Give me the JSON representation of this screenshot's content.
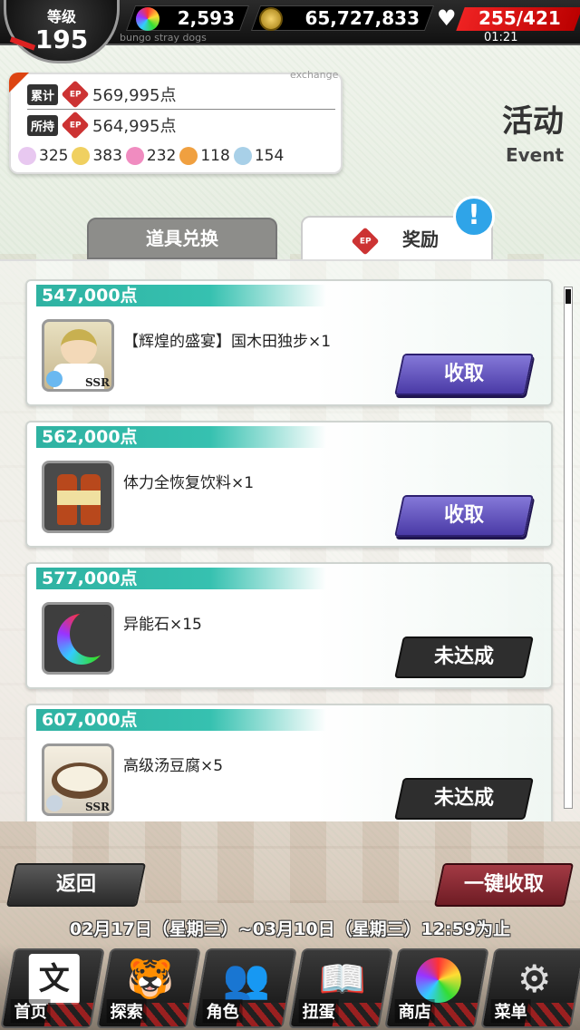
{
  "header": {
    "level_label": "等级",
    "level_value": "195",
    "gems": "2,593",
    "coins": "65,727,833",
    "stamina": "255/421",
    "stamina_timer": "01:21",
    "subtitle": "bungo stray dogs"
  },
  "points": {
    "exchange_label": "exchange",
    "total_label": "累计",
    "total_value": "569,995点",
    "owned_label": "所持",
    "owned_value": "564,995点",
    "ep_icon": "EP",
    "materials": [
      {
        "icon": "flower-icon",
        "count": "325"
      },
      {
        "icon": "ribbon-icon",
        "count": "383"
      },
      {
        "icon": "bouquet-icon",
        "count": "232"
      },
      {
        "icon": "medal-icon",
        "count": "118"
      },
      {
        "icon": "charm-icon",
        "count": "154"
      }
    ]
  },
  "event": {
    "title_cn": "活动",
    "title_en": "Event"
  },
  "tabs": {
    "exchange": "道具兑换",
    "reward": "奖励",
    "ep_icon": "EP",
    "alert": "!"
  },
  "rewards": [
    {
      "points": "547,000点",
      "name": "【辉煌的盛宴】国木田独步×1",
      "rarity": "SSR",
      "button": "收取",
      "state": "claimable"
    },
    {
      "points": "562,000点",
      "name": "体力全恢复饮料×1",
      "rarity": "",
      "button": "收取",
      "state": "claimable"
    },
    {
      "points": "577,000点",
      "name": "异能石×15",
      "rarity": "",
      "button": "未达成",
      "state": "locked"
    },
    {
      "points": "607,000点",
      "name": "高级汤豆腐×5",
      "rarity": "SSR",
      "button": "未达成",
      "state": "locked"
    }
  ],
  "footer": {
    "back": "返回",
    "claim_all": "一键收取",
    "period": "02月17日（星期三）~03月10日（星期三）12:59为止"
  },
  "nav": [
    {
      "label": "首页",
      "icon": "home-icon"
    },
    {
      "label": "探索",
      "icon": "explore-icon"
    },
    {
      "label": "角色",
      "icon": "character-icon"
    },
    {
      "label": "扭蛋",
      "icon": "gacha-icon"
    },
    {
      "label": "商店",
      "icon": "shop-icon"
    },
    {
      "label": "菜单",
      "icon": "menu-icon"
    }
  ],
  "colors": {
    "accent_teal": "#36c1b0",
    "claim_purple": "#5a48b8",
    "stamina_red": "#e22222"
  }
}
